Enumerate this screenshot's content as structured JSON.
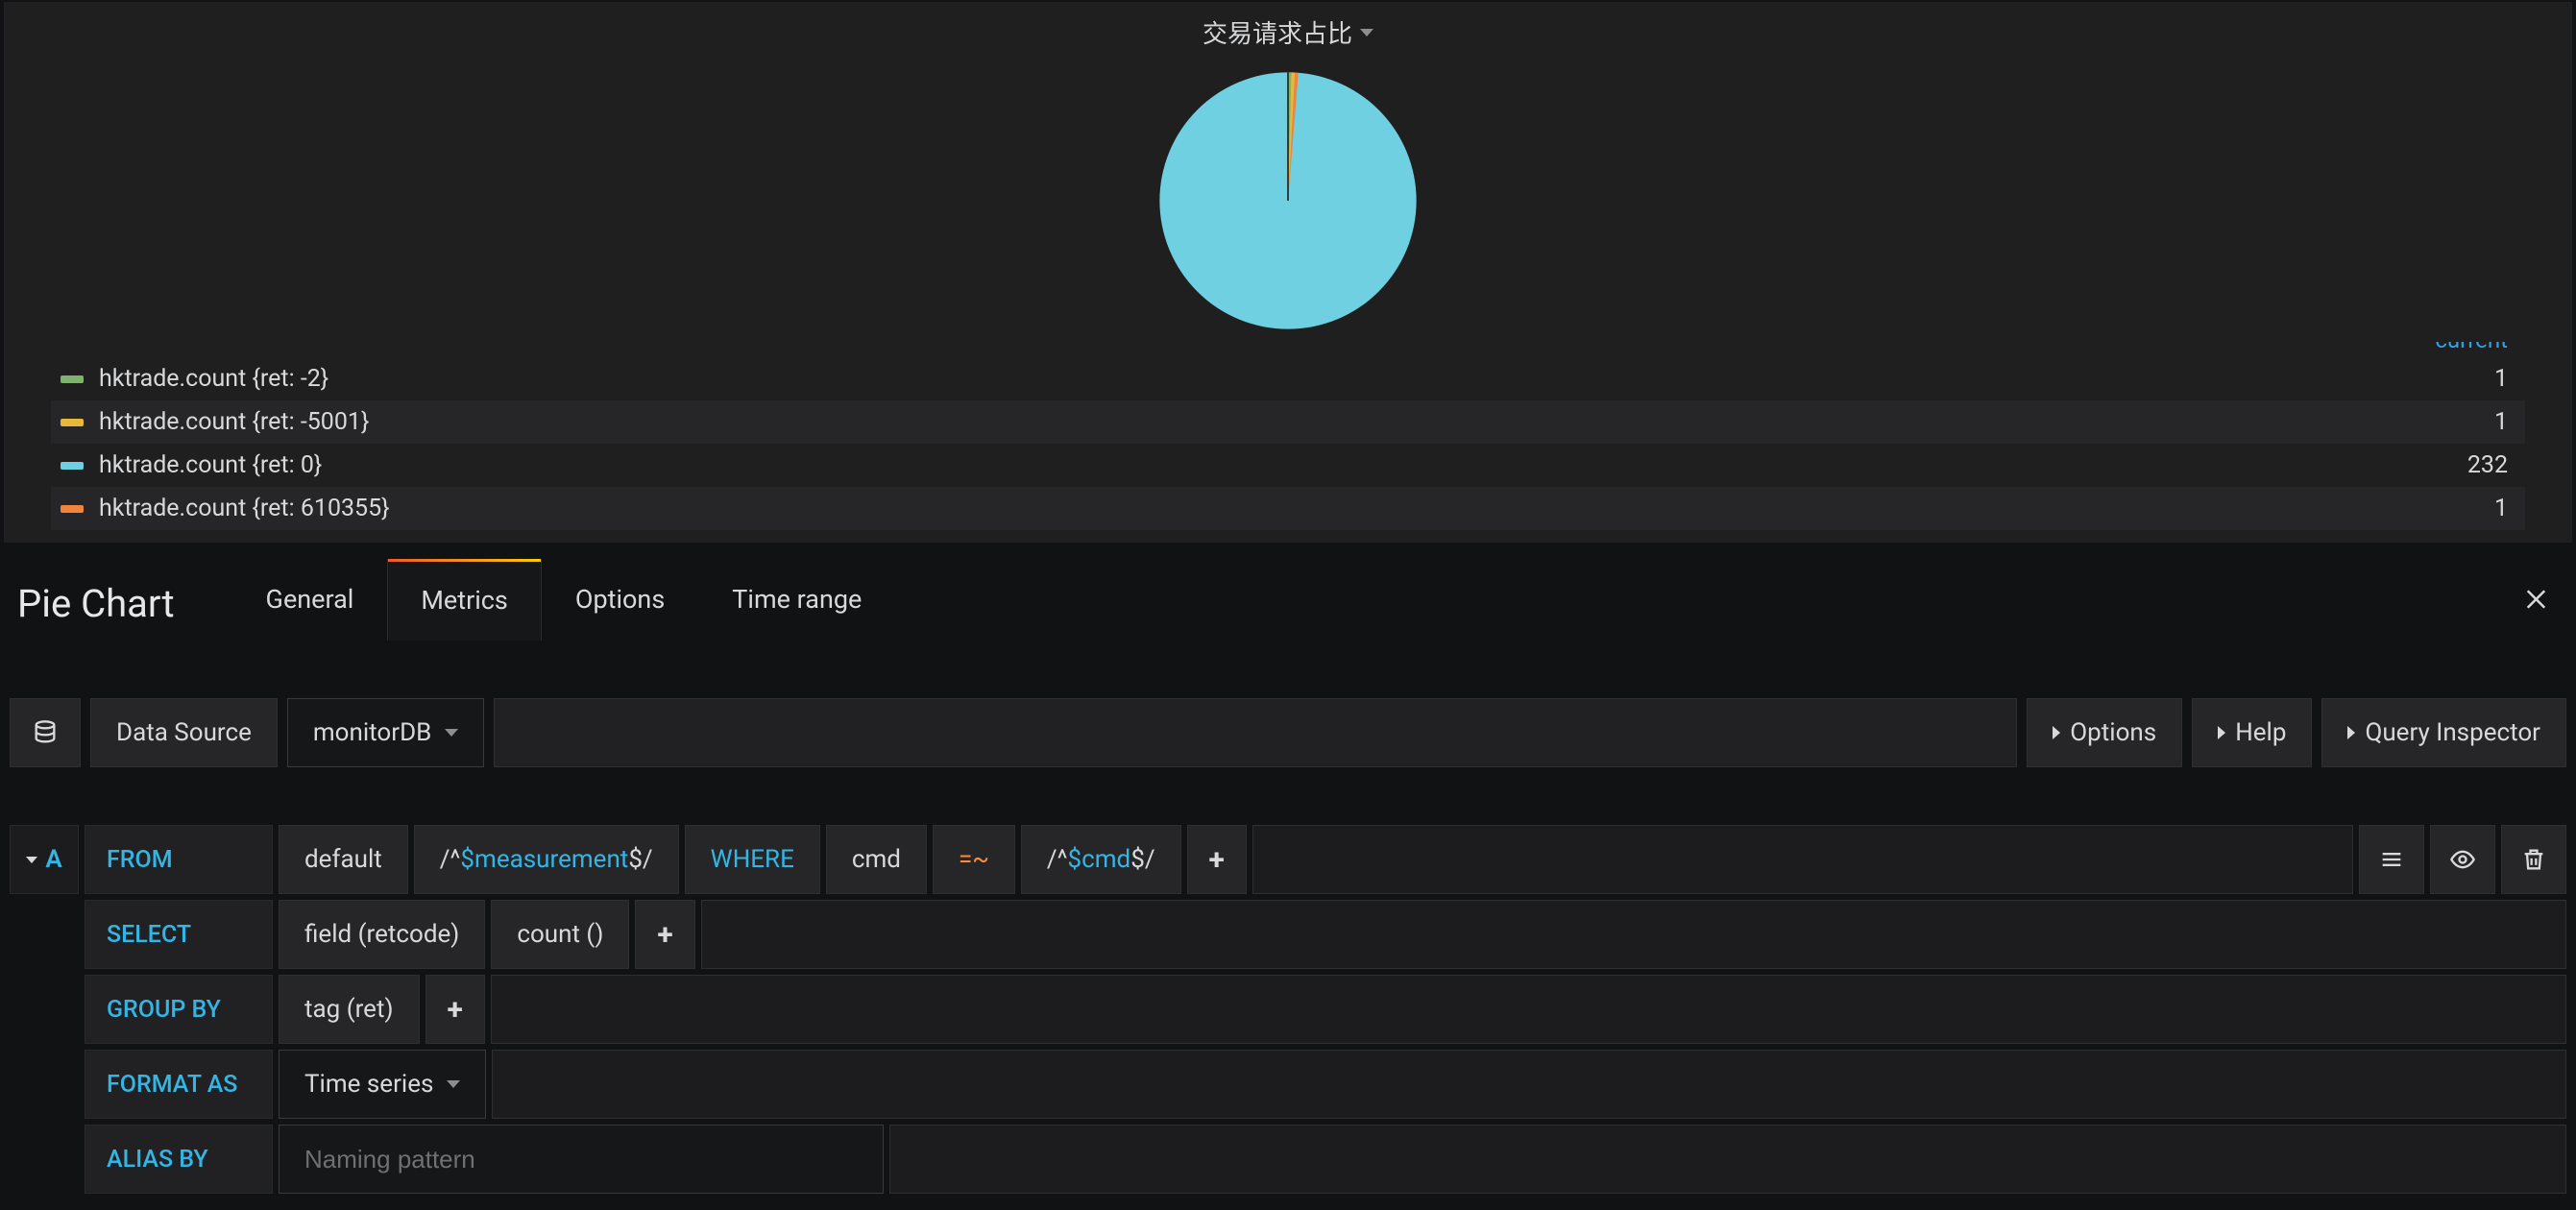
{
  "panel": {
    "title": "交易请求占比",
    "legend_header": "current",
    "series": [
      {
        "label": "hktrade.count {ret: -2}",
        "value": "1",
        "color": "#7eb26d"
      },
      {
        "label": "hktrade.count {ret: -5001}",
        "value": "1",
        "color": "#eab839"
      },
      {
        "label": "hktrade.count {ret: 0}",
        "value": "232",
        "color": "#6ed0e0"
      },
      {
        "label": "hktrade.count {ret: 610355}",
        "value": "1",
        "color": "#ef843c"
      }
    ]
  },
  "chart_data": {
    "type": "pie",
    "title": "交易请求占比",
    "categories": [
      "hktrade.count {ret: -2}",
      "hktrade.count {ret: -5001}",
      "hktrade.count {ret: 0}",
      "hktrade.count {ret: 610355}"
    ],
    "values": [
      1,
      1,
      232,
      1
    ],
    "colors": [
      "#7eb26d",
      "#eab839",
      "#6ed0e0",
      "#ef843c"
    ]
  },
  "editor": {
    "panel_type": "Pie Chart",
    "tabs": [
      "General",
      "Metrics",
      "Options",
      "Time range"
    ],
    "active_tab": "Metrics"
  },
  "datasource": {
    "label": "Data Source",
    "selected": "monitorDB",
    "options_btn": "Options",
    "help_btn": "Help",
    "inspector_btn": "Query Inspector"
  },
  "query": {
    "letter": "A",
    "from": {
      "label": "FROM",
      "policy": "default",
      "measurement_prefix": "/^",
      "measurement_var": "$measurement",
      "measurement_suffix": "$/",
      "where_label": "WHERE",
      "tag_key": "cmd",
      "operator": "=~",
      "tag_value_prefix": "/^",
      "tag_value_var": "$cmd",
      "tag_value_suffix": "$/"
    },
    "select": {
      "label": "SELECT",
      "field": "field (retcode)",
      "func": "count ()"
    },
    "groupby": {
      "label": "GROUP BY",
      "tag": "tag (ret)"
    },
    "format": {
      "label": "FORMAT AS",
      "value": "Time series"
    },
    "alias": {
      "label": "ALIAS BY",
      "placeholder": "Naming pattern",
      "value": ""
    }
  }
}
